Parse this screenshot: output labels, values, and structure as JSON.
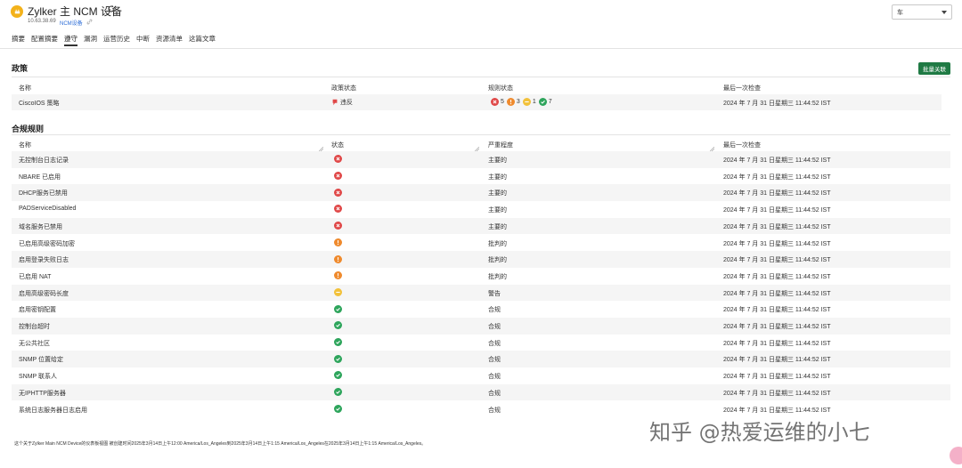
{
  "device": {
    "title": "Zylker 主 NCM 设备",
    "ip": "10.63.38.69",
    "type_link": "NCM设备",
    "icon": "router-icon"
  },
  "select": {
    "value": "车"
  },
  "tabs": [
    {
      "label": "摘要",
      "active": false
    },
    {
      "label": "配置摘要",
      "active": false
    },
    {
      "label": "遵守",
      "active": true
    },
    {
      "label": "漏洞",
      "active": false
    },
    {
      "label": "运营历史",
      "active": false
    },
    {
      "label": "中断",
      "active": false
    },
    {
      "label": "资源清单",
      "active": false
    },
    {
      "label": "这篇文章",
      "active": false
    }
  ],
  "policy": {
    "section_title": "政策",
    "batch_button": "批量关联",
    "headers": {
      "name": "名称",
      "status": "政策状态",
      "rule_status": "规则状态",
      "last_check": "最后一次检查"
    },
    "row": {
      "name": "CiscoIOS 策略",
      "status": "违反",
      "counts": {
        "critical": "5",
        "major": "3",
        "warning": "1",
        "compliant": "7"
      },
      "last_check": "2024 年 7 月 31 日星期三 11:44:52 IST"
    }
  },
  "compliance": {
    "section_title": "合规规则",
    "headers": {
      "name": "名称",
      "status": "状态",
      "severity": "严重程度",
      "last_check": "最后一次检查"
    },
    "rows": [
      {
        "name": "无控制台日志记录",
        "status": "red",
        "severity": "主要的",
        "last_check": "2024 年 7 月 31 日星期三 11:44:52 IST"
      },
      {
        "name": "NBARE 已启用",
        "status": "red",
        "severity": "主要的",
        "last_check": "2024 年 7 月 31 日星期三 11:44:52 IST"
      },
      {
        "name": "DHCP服务已禁用",
        "status": "red",
        "severity": "主要的",
        "last_check": "2024 年 7 月 31 日星期三 11:44:52 IST"
      },
      {
        "name": "PADServiceDisabled",
        "status": "red",
        "severity": "主要的",
        "last_check": "2024 年 7 月 31 日星期三 11:44:52 IST"
      },
      {
        "name": "域名服务已禁用",
        "status": "red",
        "severity": "主要的",
        "last_check": "2024 年 7 月 31 日星期三 11:44:52 IST"
      },
      {
        "name": "已启用高级密码加密",
        "status": "orange",
        "severity": "批判的",
        "last_check": "2024 年 7 月 31 日星期三 11:44:52 IST"
      },
      {
        "name": "启用登录失败日志",
        "status": "orange",
        "severity": "批判的",
        "last_check": "2024 年 7 月 31 日星期三 11:44:52 IST"
      },
      {
        "name": "已启用 NAT",
        "status": "orange",
        "severity": "批判的",
        "last_check": "2024 年 7 月 31 日星期三 11:44:52 IST"
      },
      {
        "name": "启用高级密码长度",
        "status": "yellow",
        "severity": "警告",
        "last_check": "2024 年 7 月 31 日星期三 11:44:52 IST"
      },
      {
        "name": "启用密钥配置",
        "status": "green",
        "severity": "合规",
        "last_check": "2024 年 7 月 31 日星期三 11:44:52 IST"
      },
      {
        "name": "控制台超时",
        "status": "green",
        "severity": "合规",
        "last_check": "2024 年 7 月 31 日星期三 11:44:52 IST"
      },
      {
        "name": "无公共社区",
        "status": "green",
        "severity": "合规",
        "last_check": "2024 年 7 月 31 日星期三 11:44:52 IST"
      },
      {
        "name": "SNMP 位置给定",
        "status": "green",
        "severity": "合规",
        "last_check": "2024 年 7 月 31 日星期三 11:44:52 IST"
      },
      {
        "name": "SNMP 联系人",
        "status": "green",
        "severity": "合规",
        "last_check": "2024 年 7 月 31 日星期三 11:44:52 IST"
      },
      {
        "name": "无IPHTTP服务器",
        "status": "green",
        "severity": "合规",
        "last_check": "2024 年 7 月 31 日星期三 11:44:52 IST"
      },
      {
        "name": "系统日志服务器日志启用",
        "status": "green",
        "severity": "合规",
        "last_check": "2024 年 7 月 31 日星期三 11:44:52 IST"
      }
    ]
  },
  "footer": {
    "note": "这个关于Zylker Main NCM Device的仪表板视图 被创建时间2025年3月14日上午12:00 America/Los_Angeles到2025年3月14日上午1:15 America/Los_Angeles在2025年3月14日上午1:15 America/Los_Angeles。"
  },
  "watermark": "知乎 @热爱运维的小七",
  "colors": {
    "critical": "#e04848",
    "major": "#ef8a2d",
    "warning": "#f2c13a",
    "compliant": "#2ea55c",
    "button": "#1f7a44",
    "link": "#2a6bd6"
  }
}
